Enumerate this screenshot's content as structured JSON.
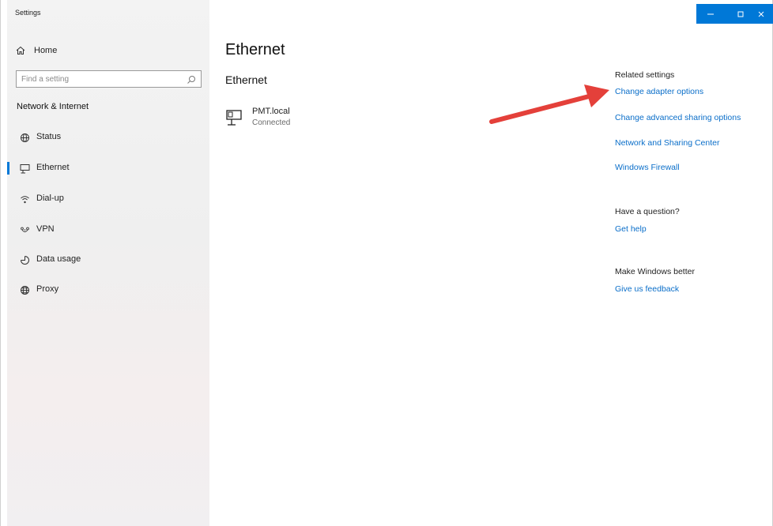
{
  "window": {
    "title": "Settings",
    "controls": [
      "minimize-icon",
      "maximize-icon",
      "close-icon"
    ],
    "accent_color": "#0078d7"
  },
  "sidebar": {
    "home_label": "Home",
    "search": {
      "placeholder": "Find a setting",
      "value": ""
    },
    "section_title": "Network & Internet",
    "items": [
      {
        "label": "Status",
        "icon": "globe-status-icon",
        "active": false
      },
      {
        "label": "Ethernet",
        "icon": "ethernet-icon",
        "active": true
      },
      {
        "label": "Dial-up",
        "icon": "dialup-icon",
        "active": false
      },
      {
        "label": "VPN",
        "icon": "vpn-icon",
        "active": false
      },
      {
        "label": "Data usage",
        "icon": "data-usage-icon",
        "active": false
      },
      {
        "label": "Proxy",
        "icon": "globe-icon",
        "active": false
      }
    ]
  },
  "main": {
    "title": "Ethernet",
    "subtitle": "Ethernet",
    "connection": {
      "name": "PMT.local",
      "status": "Connected",
      "icon": "network-computer-icon"
    }
  },
  "related": {
    "heading": "Related settings",
    "links": [
      "Change adapter options",
      "Change advanced sharing options",
      "Network and Sharing Center",
      "Windows Firewall"
    ]
  },
  "question": {
    "heading": "Have a question?",
    "link": "Get help"
  },
  "feedback": {
    "heading": "Make Windows better",
    "link": "Give us feedback"
  },
  "annotation": {
    "icon": "red-arrow-icon",
    "color": "#e4403a"
  },
  "colors": {
    "link": "#0a6ec9",
    "active_bar": "#0078d7"
  }
}
